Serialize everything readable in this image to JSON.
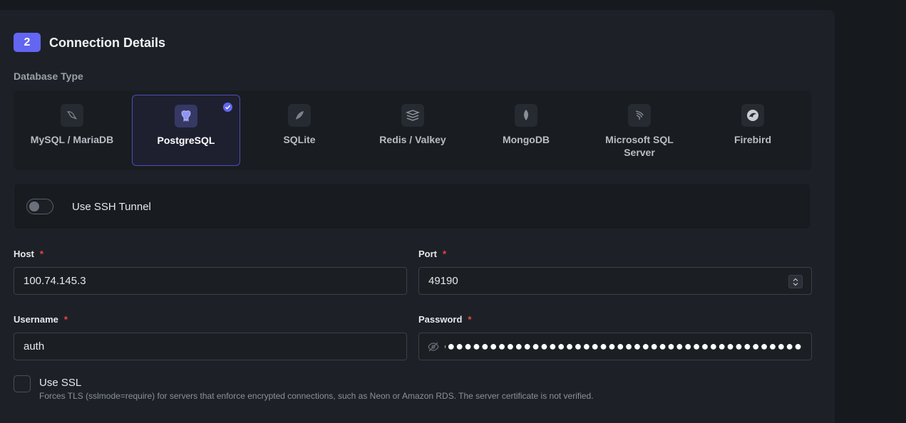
{
  "section": {
    "step": "2",
    "title": "Connection Details"
  },
  "database_type": {
    "label": "Database Type",
    "selected": "PostgreSQL",
    "options": [
      {
        "label": "MySQL / MariaDB",
        "icon": "dolphin-icon"
      },
      {
        "label": "PostgreSQL",
        "icon": "elephant-icon"
      },
      {
        "label": "SQLite",
        "icon": "feather-icon"
      },
      {
        "label": "Redis / Valkey",
        "icon": "stack-icon"
      },
      {
        "label": "MongoDB",
        "icon": "leaf-icon"
      },
      {
        "label": "Microsoft SQL Server",
        "icon": "sqlserver-icon"
      },
      {
        "label": "Firebird",
        "icon": "firebird-icon"
      }
    ]
  },
  "ssh": {
    "label": "Use SSH Tunnel",
    "enabled": false
  },
  "host": {
    "label": "Host",
    "value": "100.74.145.3"
  },
  "port": {
    "label": "Port",
    "value": "49190"
  },
  "username": {
    "label": "Username",
    "value": "auth"
  },
  "password": {
    "label": "Password",
    "value": "●●●●●●●●●●●●●●●●●●●●●●●●●●●●●●●●●●●●●●●●●●●●●●●●●●●●●●●●●●●●●●●●"
  },
  "ssl": {
    "label": "Use SSL",
    "checked": false,
    "help": "Forces TLS (sslmode=require) for servers that enforce encrypted connections, such as Neon or Amazon RDS. The server certificate is not verified."
  },
  "colors": {
    "accent": "#6366f1",
    "required": "#ef4444",
    "background": "#1d2127"
  }
}
